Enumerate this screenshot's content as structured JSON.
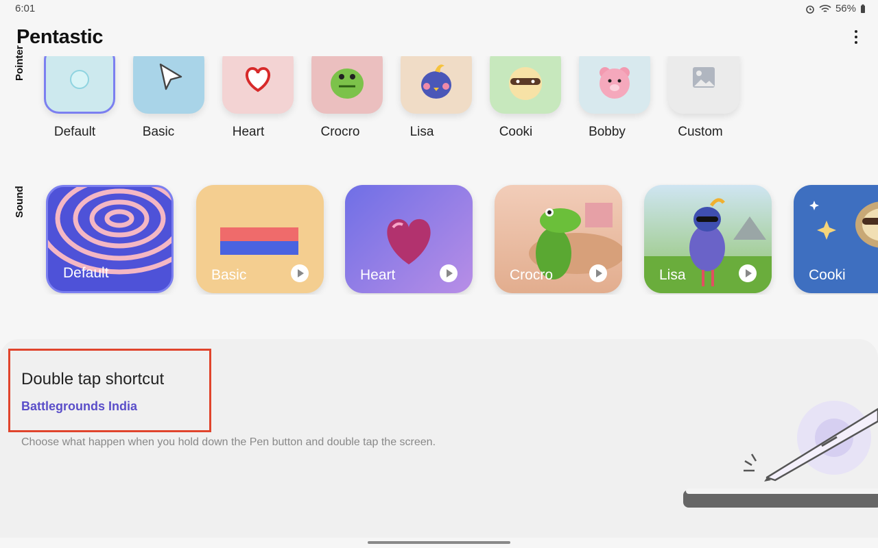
{
  "status": {
    "time": "6:01",
    "battery": "56%"
  },
  "appbar": {
    "title": "Pentastic"
  },
  "pointer": {
    "label": "Pointer",
    "items": [
      "Default",
      "Basic",
      "Heart",
      "Crocro",
      "Lisa",
      "Cooki",
      "Bobby",
      "Custom"
    ],
    "selected": "Default"
  },
  "sound": {
    "label": "Sound",
    "items": [
      "Default",
      "Basic",
      "Heart",
      "Crocro",
      "Lisa",
      "Cooki"
    ],
    "selected": "Default"
  },
  "double_tap": {
    "title": "Double tap shortcut",
    "value": "Battlegrounds India",
    "description": "Choose what happen when you hold down the Pen button and double tap the screen."
  },
  "colors": {
    "accent": "#5a4ec9",
    "highlight": "#e0442c",
    "selected_border": "#7b7ff0"
  }
}
